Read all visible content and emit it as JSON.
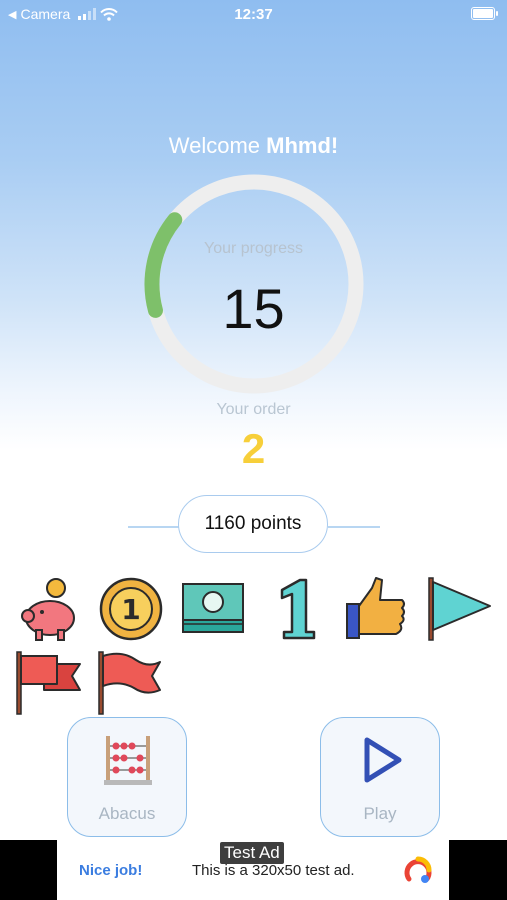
{
  "status_bar": {
    "back_app": "Camera",
    "time": "12:37",
    "icons": [
      "signal-icon",
      "wifi-icon",
      "battery-icon"
    ]
  },
  "welcome": {
    "greeting": "Welcome",
    "username": "Mhmd!"
  },
  "progress": {
    "label": "Your progress",
    "value": "15",
    "fraction": 0.15,
    "color": "#7ec06a",
    "track_color": "#eeeeee"
  },
  "order": {
    "label": "Your order",
    "value": "2",
    "color": "#f7cf3a"
  },
  "points": {
    "label": "1160 points"
  },
  "badges": [
    "piggy-bank-icon",
    "gold-coin-icon",
    "money-stack-icon",
    "number-one-icon",
    "thumbs-up-icon",
    "cyan-pennant-icon",
    "red-flag-icon",
    "red-wave-flag-icon"
  ],
  "nav": {
    "abacus_label": "Abacus",
    "play_label": "Play"
  },
  "ad": {
    "tag": "Test Ad",
    "title": "Nice job!",
    "text": "This is a 320x50 test ad."
  }
}
